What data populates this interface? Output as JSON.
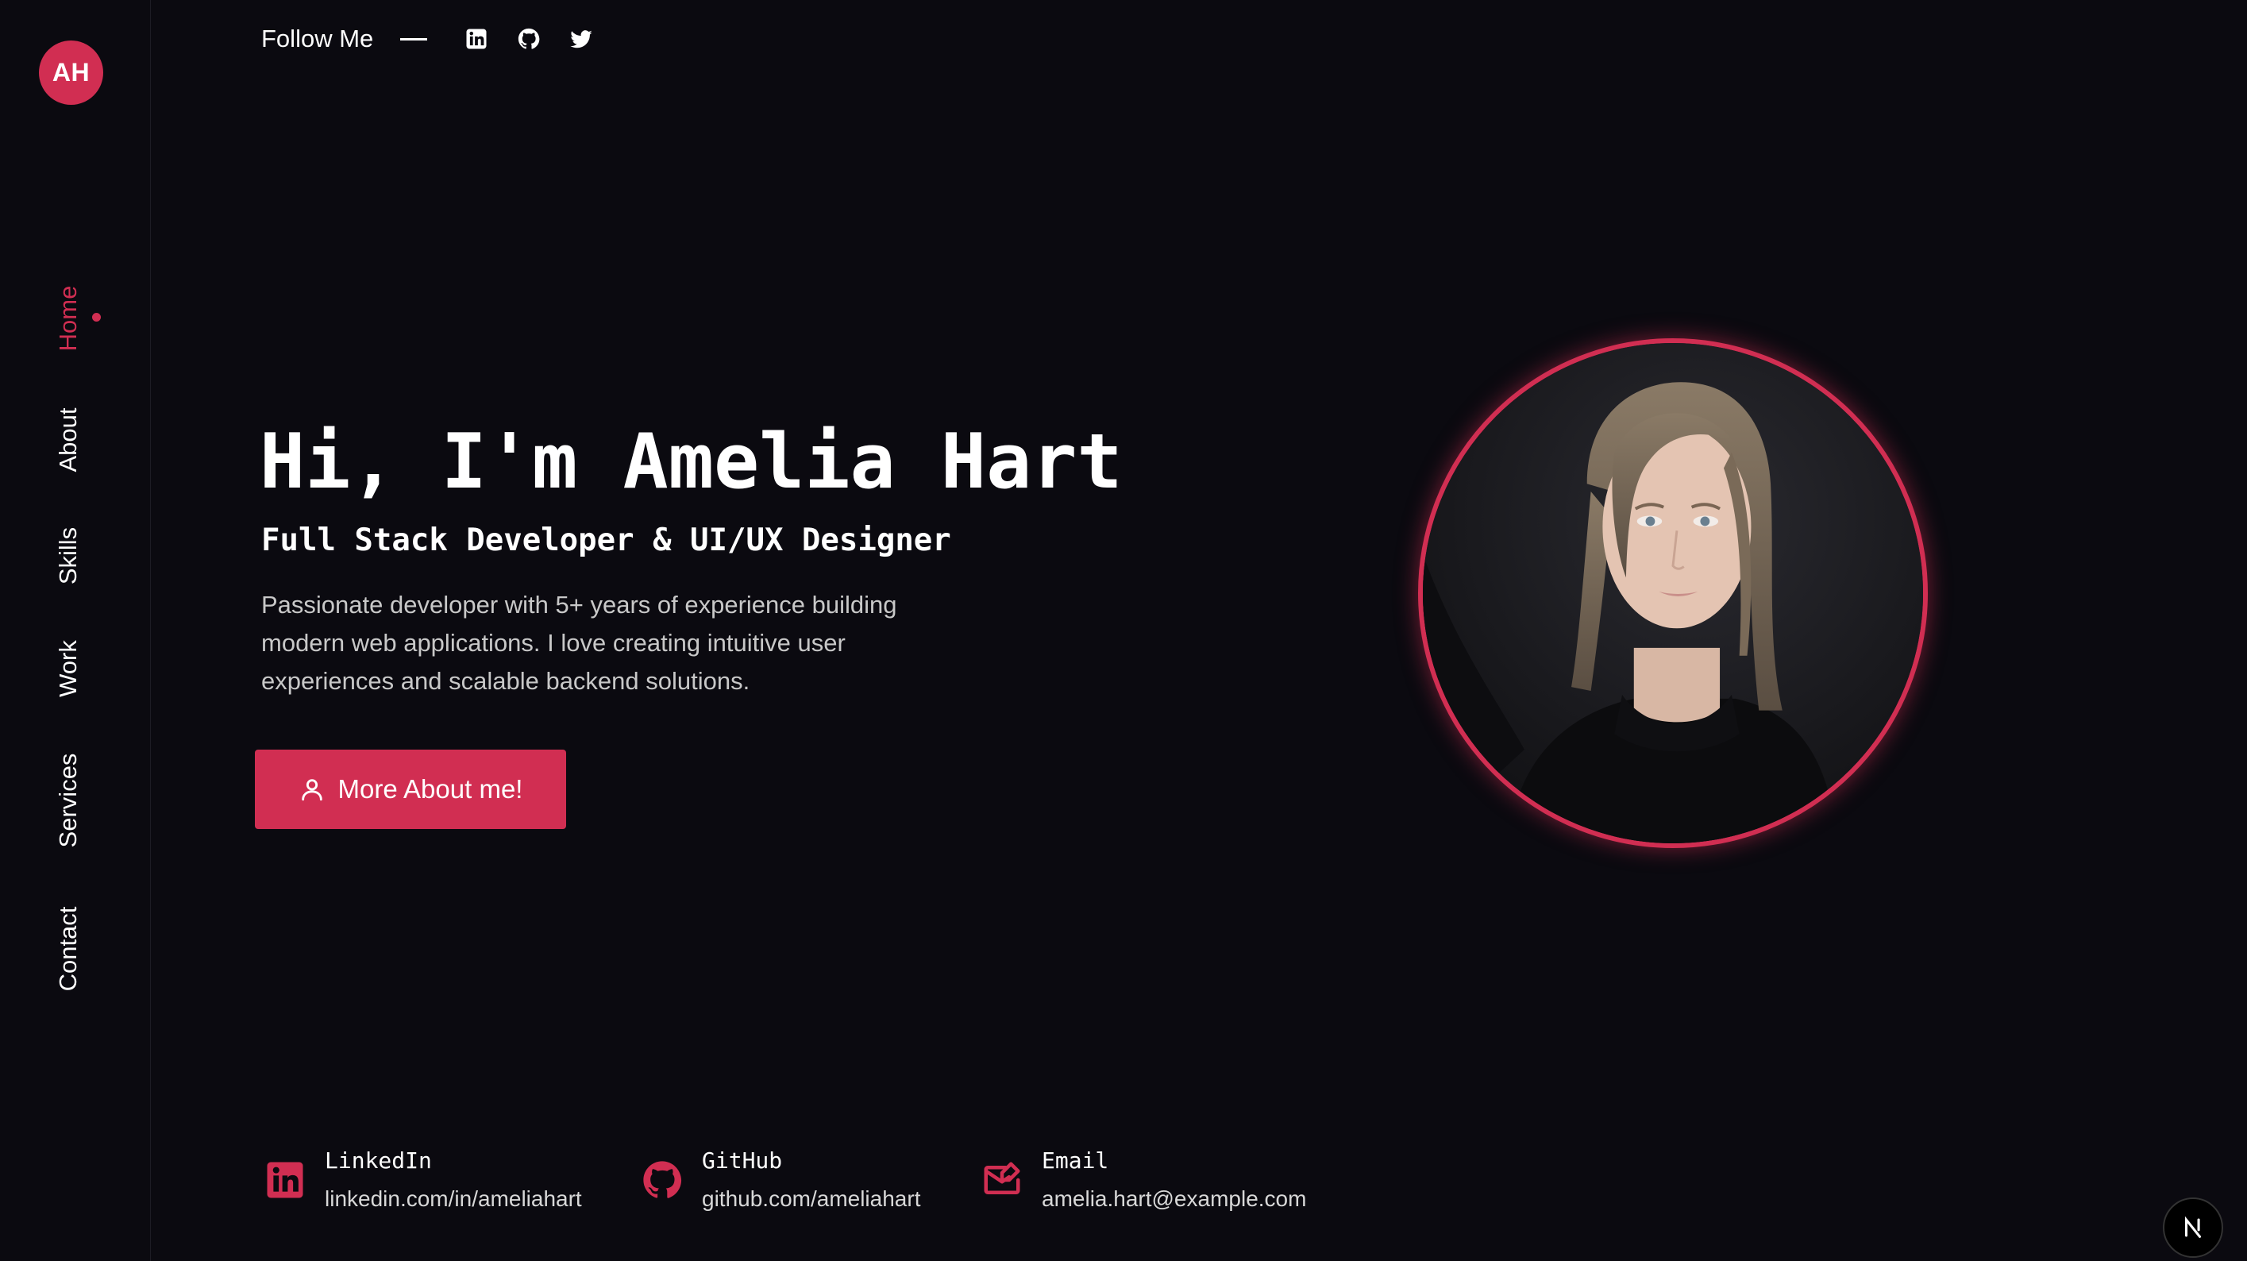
{
  "logo": {
    "initials": "AH"
  },
  "sidebar": {
    "items": [
      {
        "label": "Home",
        "active": true
      },
      {
        "label": "About",
        "active": false
      },
      {
        "label": "Skills",
        "active": false
      },
      {
        "label": "Work",
        "active": false
      },
      {
        "label": "Services",
        "active": false
      },
      {
        "label": "Contact",
        "active": false
      }
    ]
  },
  "follow": {
    "label": "Follow Me",
    "icons": [
      "linkedin-icon",
      "github-icon",
      "twitter-icon"
    ]
  },
  "hero": {
    "title": "Hi, I'm Amelia Hart",
    "subtitle": "Full Stack Developer & UI/UX Designer",
    "description": "Passionate developer with 5+ years of experience building modern web applications. I love creating intuitive user experiences and scalable backend solutions.",
    "cta_label": "More About me!",
    "cta_icon": "user-icon"
  },
  "contacts": [
    {
      "icon": "linkedin-icon",
      "title": "LinkedIn",
      "value": "linkedin.com/in/ameliahart"
    },
    {
      "icon": "github-icon",
      "title": "GitHub",
      "value": "github.com/ameliahart"
    },
    {
      "icon": "mail-icon",
      "title": "Email",
      "value": "amelia.hart@example.com"
    }
  ],
  "badge": {
    "icon": "nextjs-icon"
  },
  "colors": {
    "accent": "#d12e52",
    "background": "#0b0a10",
    "text": "#ffffff",
    "muted_text": "#c8c8c8"
  }
}
